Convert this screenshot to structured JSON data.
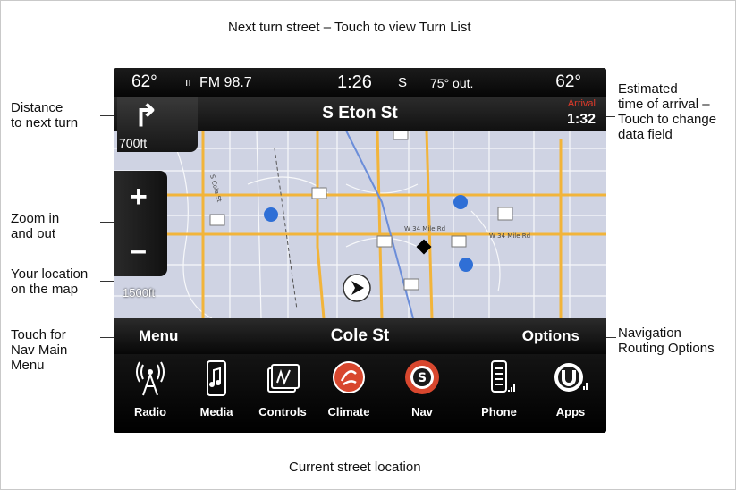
{
  "callouts": {
    "top": "Next turn street – Touch to view Turn List",
    "distance": [
      "Distance",
      "to next turn"
    ],
    "zoom": [
      "Zoom in",
      "and out"
    ],
    "location": [
      "Your location",
      "on the map"
    ],
    "nav_menu": [
      "Touch for",
      "Nav Main",
      "Menu"
    ],
    "eta": [
      "Estimated",
      "time of arrival –",
      "Touch to change",
      "data field"
    ],
    "routing": [
      "Navigation",
      "Routing Options"
    ],
    "bottom": "Current street location"
  },
  "status_bar": {
    "temp_left": "62°",
    "radio": "FM 98.7",
    "time": "1:26",
    "heading": "S",
    "outside": "75° out.",
    "temp_right": "62°"
  },
  "next_turn": {
    "street": "S Eton St",
    "distance": "700ft",
    "arrival_label": "Arrival",
    "arrival_time": "1:32"
  },
  "map": {
    "scale": "1500ft",
    "zoom_in": "+",
    "zoom_out": "–"
  },
  "bottom_bar": {
    "menu": "Menu",
    "current_street": "Cole St",
    "options": "Options"
  },
  "dock": [
    {
      "label": "Radio",
      "icon": "radio-icon"
    },
    {
      "label": "Media",
      "icon": "media-icon"
    },
    {
      "label": "Controls",
      "icon": "controls-icon"
    },
    {
      "label": "Climate",
      "icon": "climate-icon"
    },
    {
      "label": "Nav",
      "icon": "nav-icon"
    },
    {
      "label": "Phone",
      "icon": "phone-icon"
    },
    {
      "label": "Apps",
      "icon": "apps-icon"
    }
  ],
  "colors": {
    "arrival_label": "#e03a2a",
    "map_road": "#f2b43a",
    "map_bg": "#cfd3e3"
  }
}
